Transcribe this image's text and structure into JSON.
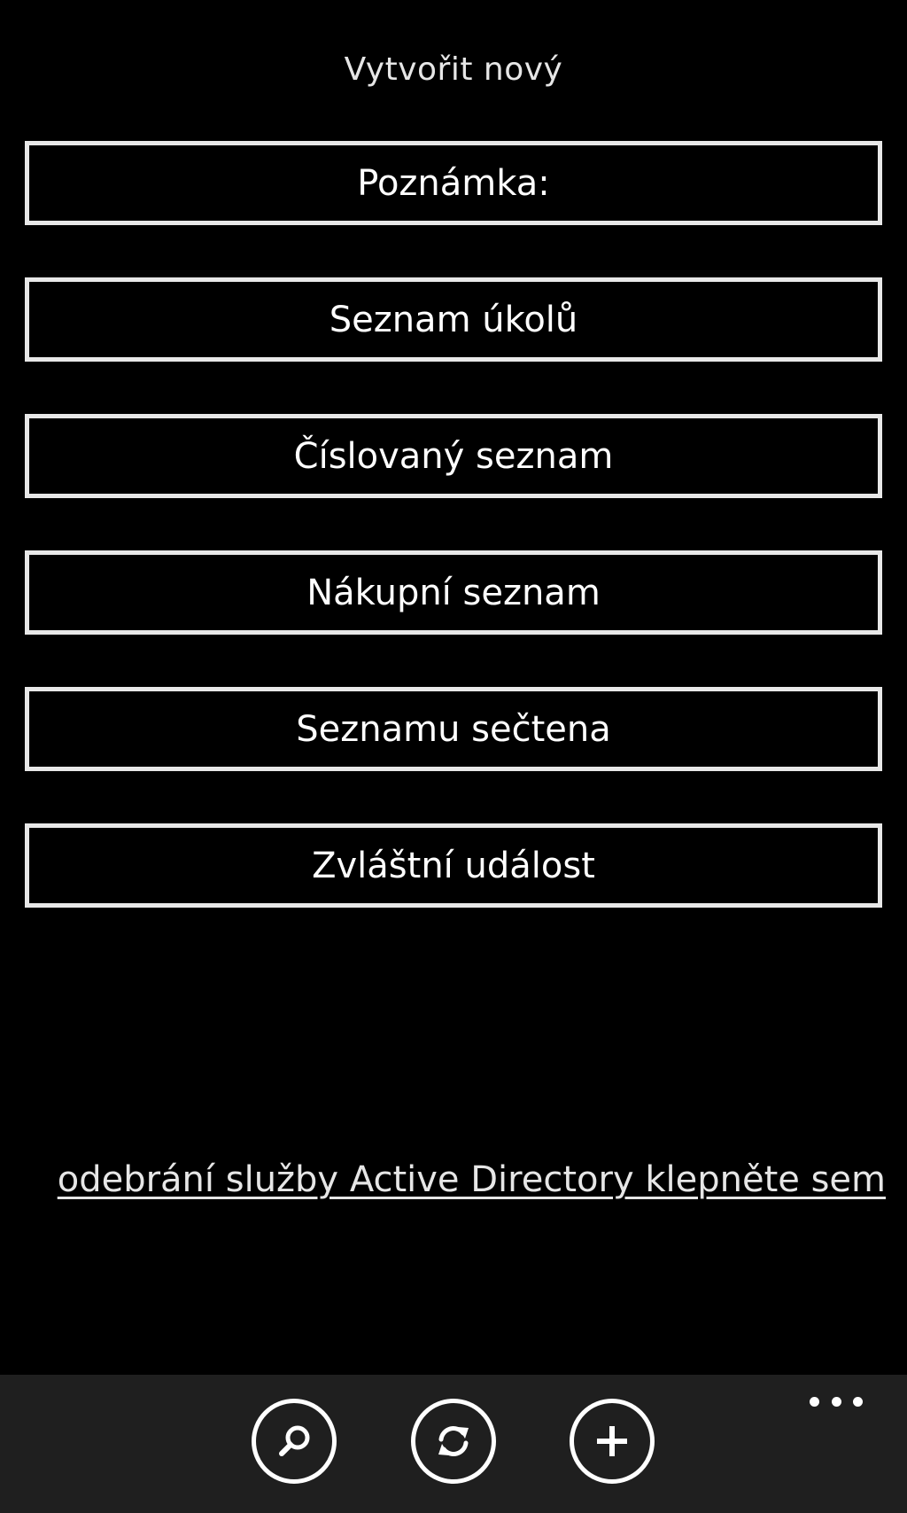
{
  "header": {
    "title": "Vytvořit nový"
  },
  "menu": {
    "items": [
      {
        "label": "Poznámka:"
      },
      {
        "label": "Seznam úkolů"
      },
      {
        "label": "Číslovaný seznam"
      },
      {
        "label": "Nákupní seznam"
      },
      {
        "label": "Seznamu sečtena"
      },
      {
        "label": "Zvláštní událost"
      }
    ]
  },
  "footer_link": {
    "text": "odebrání služby Active Directory klepněte sem"
  },
  "app_bar": {
    "buttons": [
      {
        "icon": "search-icon"
      },
      {
        "icon": "sync-icon"
      },
      {
        "icon": "add-icon"
      }
    ],
    "more_icon": "ellipsis-icon",
    "background": "#1f1f1f"
  },
  "colors": {
    "background": "#000000",
    "foreground": "#ffffff"
  }
}
